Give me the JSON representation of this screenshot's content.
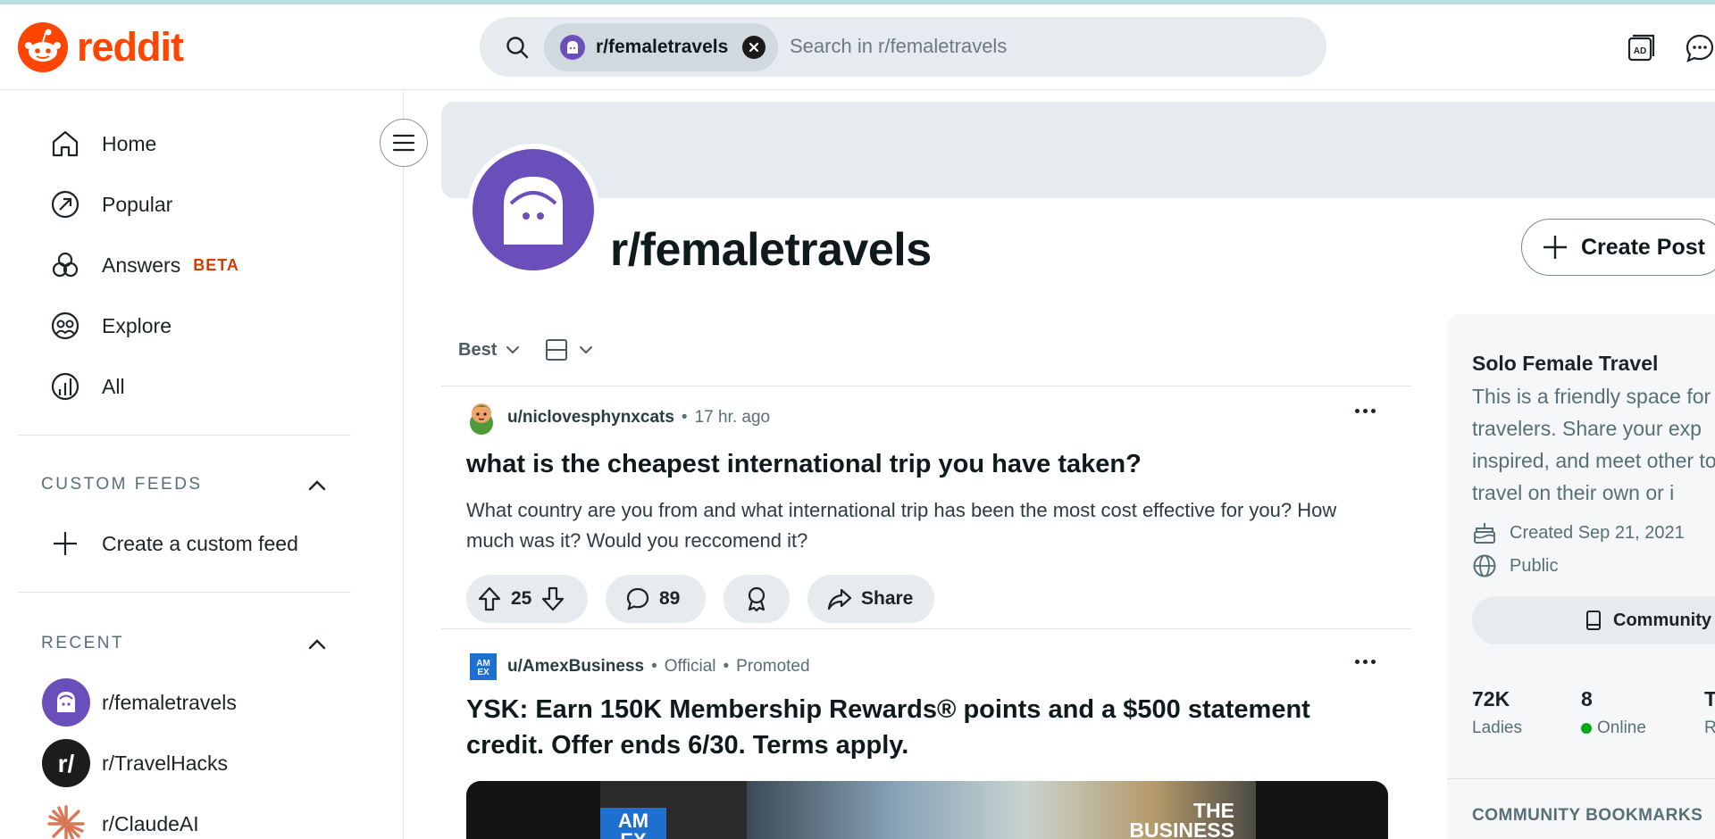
{
  "header": {
    "logo_text": "reddit",
    "search": {
      "chip_label": "r/femaletravels",
      "placeholder": "Search in r/femaletravels"
    },
    "icons": [
      "search-icon",
      "close-icon",
      "advertise-icon",
      "chat-icon"
    ]
  },
  "sidebar": {
    "nav": [
      {
        "label": "Home",
        "icon": "home-icon"
      },
      {
        "label": "Popular",
        "icon": "popular-icon"
      },
      {
        "label": "Answers",
        "badge": "BETA",
        "icon": "answers-icon"
      },
      {
        "label": "Explore",
        "icon": "explore-icon"
      },
      {
        "label": "All",
        "icon": "all-icon"
      }
    ],
    "custom_feeds": {
      "title": "CUSTOM FEEDS",
      "create_label": "Create a custom feed"
    },
    "recent": {
      "title": "RECENT",
      "items": [
        {
          "label": "r/femaletravels"
        },
        {
          "label": "r/TravelHacks"
        },
        {
          "label": "r/ClaudeAI"
        }
      ]
    }
  },
  "community": {
    "name": "r/femaletravels",
    "create_post_label": "Create Post"
  },
  "feed": {
    "sort_label": "Best",
    "posts": [
      {
        "author": "u/niclovesphynxcats",
        "time": "17 hr. ago",
        "title": "what is the cheapest international trip you have taken?",
        "body": "What country are you from and what international trip has been the most cost effective for you? How much was it? Would you reccomend it?",
        "votes": "25",
        "comments": "89",
        "share_label": "Share"
      },
      {
        "author": "u/AmexBusiness",
        "official": "Official",
        "promoted": "Promoted",
        "title_line1": "YSK: Earn 150K Membership Rewards® points and a $500 statement",
        "title_line2": "credit. Offer ends 6/30. Terms apply.",
        "image_logo_text": "AM EX",
        "image_text_line1": "THE",
        "image_text_line2": "BUSINESS"
      }
    ]
  },
  "right_panel": {
    "title": "Solo Female Travel",
    "description": "This is a friendly space for travelers. Share your exp inspired, and meet other to travel on their own or i",
    "created": "Created Sep 21, 2021",
    "visibility": "Public",
    "bookmark_button": "Community",
    "stats": [
      {
        "value": "72K",
        "label": "Ladies"
      },
      {
        "value": "8",
        "label": "Online"
      },
      {
        "value": "T",
        "label": "R"
      }
    ],
    "bookmarks_title": "COMMUNITY BOOKMARKS"
  },
  "colors": {
    "brand": "#ff4500",
    "community_avatar": "#6a4fba",
    "beta": "#d93a00",
    "online": "#01a816"
  }
}
